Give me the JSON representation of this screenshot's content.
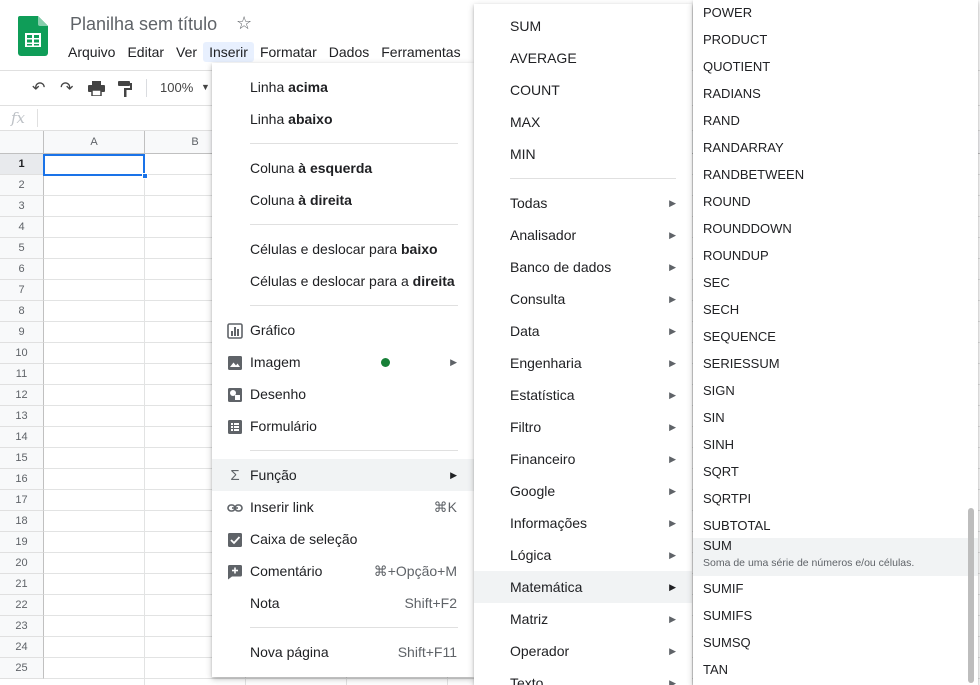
{
  "doc": {
    "title": "Planilha sem título"
  },
  "menubar": [
    "Arquivo",
    "Editar",
    "Ver",
    "Inserir",
    "Formatar",
    "Dados",
    "Ferramentas"
  ],
  "toolbar": {
    "zoom": "100%"
  },
  "grid": {
    "columns": [
      "A",
      "B"
    ],
    "rows": [
      "1",
      "2",
      "3",
      "4",
      "5",
      "6",
      "7",
      "8",
      "9",
      "10",
      "11",
      "12",
      "13",
      "14",
      "15",
      "16",
      "17",
      "18",
      "19",
      "20",
      "21",
      "22",
      "23",
      "24",
      "25"
    ]
  },
  "insert_menu": {
    "row_above": [
      "Linha ",
      "acima"
    ],
    "row_below": [
      "Linha ",
      "abaixo"
    ],
    "col_left": [
      "Coluna ",
      "à esquerda"
    ],
    "col_right": [
      "Coluna ",
      "à direita"
    ],
    "cells_down": [
      "Células e deslocar para ",
      "baixo"
    ],
    "cells_right": [
      "Células e deslocar para a ",
      "direita"
    ],
    "chart": "Gráfico",
    "image": "Imagem",
    "drawing": "Desenho",
    "form": "Formulário",
    "function": "Função",
    "link": "Inserir link",
    "link_shortcut": "⌘K",
    "checkbox": "Caixa de seleção",
    "comment": "Comentário",
    "comment_shortcut": "⌘+Opção+M",
    "note": "Nota",
    "note_shortcut": "Shift+F2",
    "new_sheet": "Nova página",
    "new_sheet_shortcut": "Shift+F11"
  },
  "function_menu": {
    "quick": [
      "SUM",
      "AVERAGE",
      "COUNT",
      "MAX",
      "MIN"
    ],
    "categories": [
      "Todas",
      "Analisador",
      "Banco de dados",
      "Consulta",
      "Data",
      "Engenharia",
      "Estatística",
      "Filtro",
      "Financeiro",
      "Google",
      "Informações",
      "Lógica",
      "Matemática",
      "Matriz",
      "Operador",
      "Texto"
    ],
    "active_category": "Matemática"
  },
  "math_menu": {
    "items": [
      "POWER",
      "PRODUCT",
      "QUOTIENT",
      "RADIANS",
      "RAND",
      "RANDARRAY",
      "RANDBETWEEN",
      "ROUND",
      "ROUNDDOWN",
      "ROUNDUP",
      "SEC",
      "SECH",
      "SEQUENCE",
      "SERIESSUM",
      "SIGN",
      "SIN",
      "SINH",
      "SQRT",
      "SQRTPI",
      "SUBTOTAL"
    ],
    "highlighted": {
      "name": "SUM",
      "description": "Soma de uma série de números e/ou células."
    },
    "items_after": [
      "SUMIF",
      "SUMIFS",
      "SUMSQ",
      "TAN"
    ]
  },
  "colors": {
    "accent": "#1a73e8",
    "sheets_green": "#0f9d58",
    "status_dot": "#188038"
  }
}
